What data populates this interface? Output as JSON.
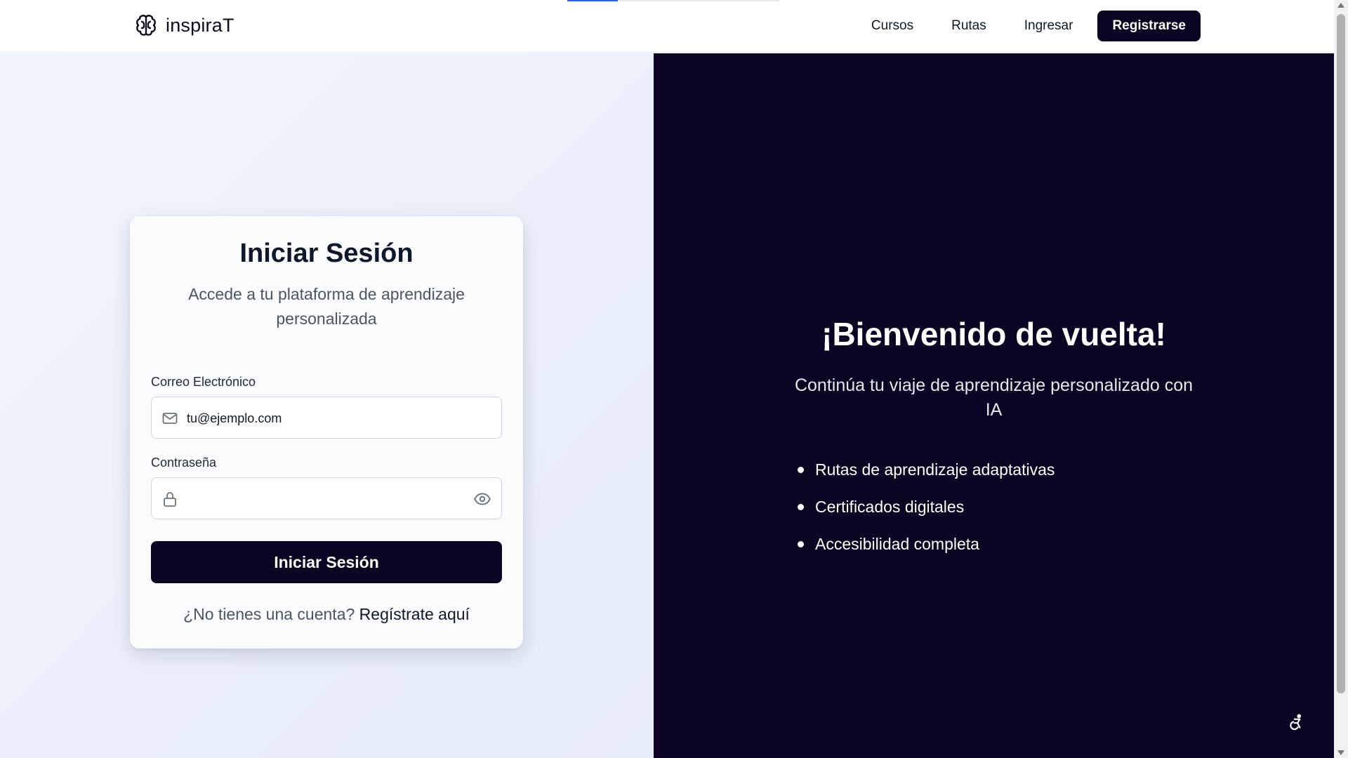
{
  "brand": {
    "name": "inspiraT",
    "icon": "brain-icon"
  },
  "nav": {
    "links": [
      "Cursos",
      "Rutas",
      "Ingresar"
    ],
    "cta": "Registrarse",
    "progress": 0.24
  },
  "login": {
    "title": "Iniciar Sesión",
    "subtitle": "Accede a tu plataforma de aprendizaje personalizada",
    "email_label": "Correo Electrónico",
    "email_value": "tu@ejemplo.com",
    "email_icon": "mail-icon",
    "password_label": "Contraseña",
    "password_value": "",
    "password_icon": "lock-icon",
    "show_password_icon": "eye-icon",
    "submit_label": "Iniciar Sesión",
    "register_prompt": "¿No tienes una cuenta?",
    "register_link": "Regístrate aquí"
  },
  "welcome": {
    "title": "¡Bienvenido de vuelta!",
    "subtitle": "Continúa tu viaje de aprendizaje personalizado con IA",
    "features": [
      "Rutas de aprendizaje adaptativas",
      "Certificados digitales",
      "Accesibilidad completa"
    ]
  },
  "accessibility_icon": "accessibility-icon",
  "colors": {
    "primary": "#0b0523",
    "accent_progress": "#2563eb",
    "left_bg": "#eef2fc",
    "card_bg": "#fafbfd"
  }
}
